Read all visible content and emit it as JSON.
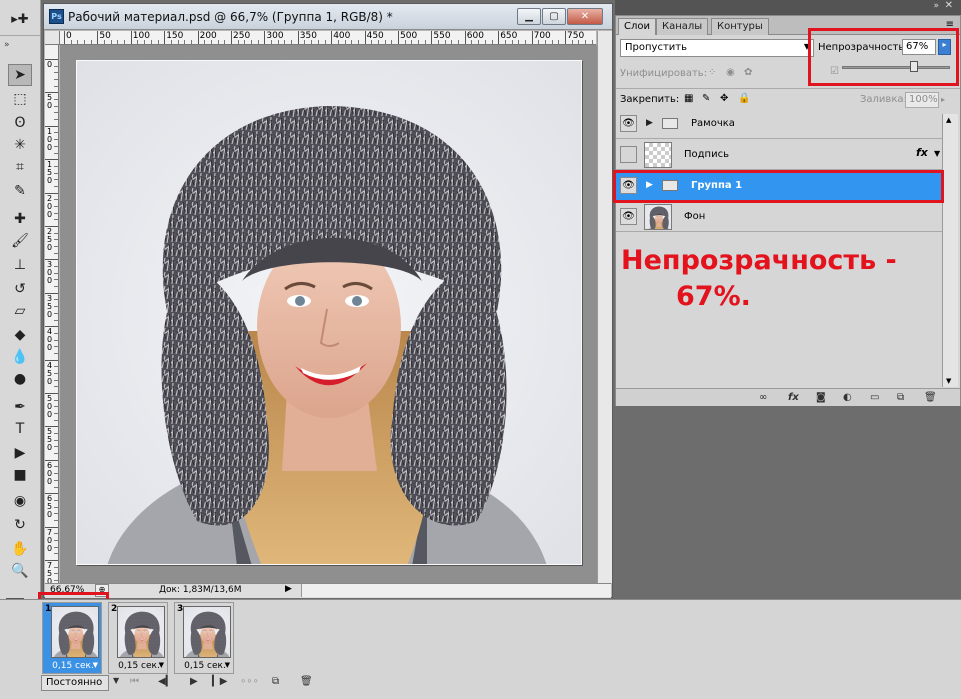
{
  "document": {
    "title": "Рабочий материал.psd @ 66,7% (Группа 1, RGB/8) *",
    "app_icon": "Ps",
    "ruler_top_ticks": [
      "0",
      "50",
      "100",
      "150",
      "200",
      "250",
      "300",
      "350",
      "400",
      "450",
      "500",
      "550",
      "600",
      "650",
      "700",
      "750"
    ],
    "ruler_left_ticks": [
      "0",
      "50",
      "100",
      "150",
      "200",
      "250",
      "300",
      "350",
      "400",
      "450",
      "500",
      "550",
      "600",
      "650",
      "700",
      "750"
    ],
    "zoom": "66,67%",
    "doc_info": "Док: 1,83M/13,6M"
  },
  "layers_panel": {
    "tabs": [
      "Слои",
      "Каналы",
      "Контуры"
    ],
    "blend_mode": "Пропустить",
    "opacity_label": "Непрозрачность:",
    "opacity_value": "67%",
    "opacity_fraction": 0.67,
    "unify_label": "Унифицировать:",
    "lock_label": "Закрепить:",
    "fill_label": "Заливка:",
    "fill_value": "100%",
    "layers": [
      {
        "name": "Рамочка",
        "type": "group",
        "visible": true,
        "selected": false
      },
      {
        "name": "Подпись",
        "type": "layer",
        "visible": false,
        "selected": false,
        "fx": "fx"
      },
      {
        "name": "Группа 1",
        "type": "group",
        "visible": true,
        "selected": true
      },
      {
        "name": "Фон",
        "type": "layer",
        "visible": true,
        "selected": false
      }
    ]
  },
  "annotation": {
    "line1": "Непрозрачность -",
    "line2": "67%."
  },
  "animation": {
    "frames": [
      {
        "number": "1",
        "delay": "0,15 сек.",
        "selected": true
      },
      {
        "number": "2",
        "delay": "0,15 сек.",
        "selected": false
      },
      {
        "number": "3",
        "delay": "0,15 сек.",
        "selected": false
      }
    ],
    "loop": "Постоянно"
  },
  "colors": {
    "selection": "#3295f0",
    "highlight_red": "#e0141e"
  }
}
